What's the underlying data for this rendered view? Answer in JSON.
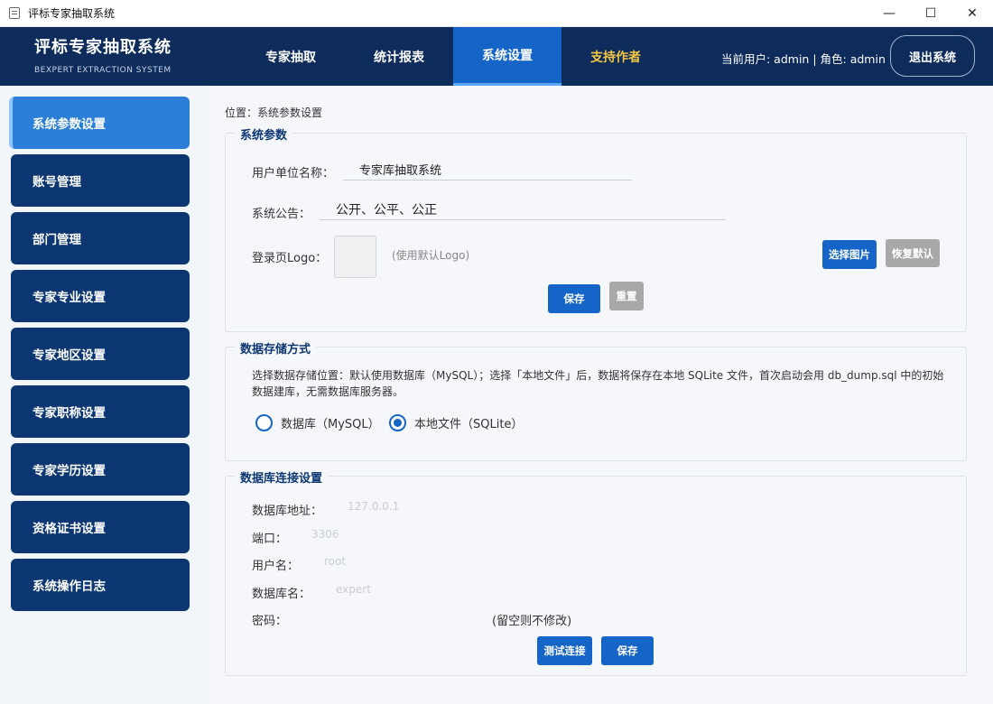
{
  "window": {
    "title": "评标专家抽取系统",
    "controls": {
      "minimize": "—",
      "maximize": "☐",
      "close": "✕"
    }
  },
  "header": {
    "title": "评标专家抽取系统",
    "subtitle": "BEXPERT EXTRACTION SYSTEM",
    "nav": [
      "专家抽取",
      "统计报表",
      "系统设置",
      "支持作者"
    ],
    "active_nav": "系统设置",
    "user_info": "当前用户: admin | 角色: admin",
    "logout": "退出系统"
  },
  "sidebar": {
    "items": [
      "系统参数设置",
      "账号管理",
      "部门管理",
      "专家专业设置",
      "专家地区设置",
      "专家职称设置",
      "专家学历设置",
      "资格证书设置",
      "系统操作日志"
    ],
    "active": "系统参数设置"
  },
  "main": {
    "breadcrumb": "位置：系统参数设置",
    "system_params": {
      "title": "系统参数",
      "org_label": "用户单位名称：",
      "org_value": "专家库抽取系统",
      "notice_label": "系统公告：",
      "notice_value": "公开、公平、公正",
      "logo_label": "登录页Logo：",
      "logo_hint": "(使用默认Logo)",
      "select_image": "选择图片",
      "restore_default": "恢复默认",
      "save": "保存",
      "reset": "重置"
    },
    "storage": {
      "title": "数据存储方式",
      "description": "选择数据存储位置：默认使用数据库（MySQL）；选择「本地文件」后，数据将保存在本地 SQLite 文件，首次启动会用 db_dump.sql 中的初始数据建库，无需数据库服务器。",
      "option_mysql": "数据库（MySQL）",
      "option_sqlite": "本地文件（SQLite）",
      "selected": "sqlite"
    },
    "db_connection": {
      "title": "数据库连接设置",
      "host_label": "数据库地址：",
      "host_value": "127.0.0.1",
      "port_label": "端口：",
      "port_value": "3306",
      "user_label": "用户名：",
      "user_value": "root",
      "dbname_label": "数据库名：",
      "dbname_value": "expert",
      "password_label": "密码：",
      "password_hint": "(留空则不修改)",
      "test_connection": "测试连接",
      "save": "保存"
    }
  },
  "colors": {
    "header_bg": "#0d2c5c",
    "nav_active": "#1565c8",
    "support_text": "#f4c542",
    "sidebar_item": "#0d3772",
    "sidebar_active": "#2b7fd9",
    "primary_button": "#1565c8",
    "secondary_button": "#a8a8a8"
  }
}
